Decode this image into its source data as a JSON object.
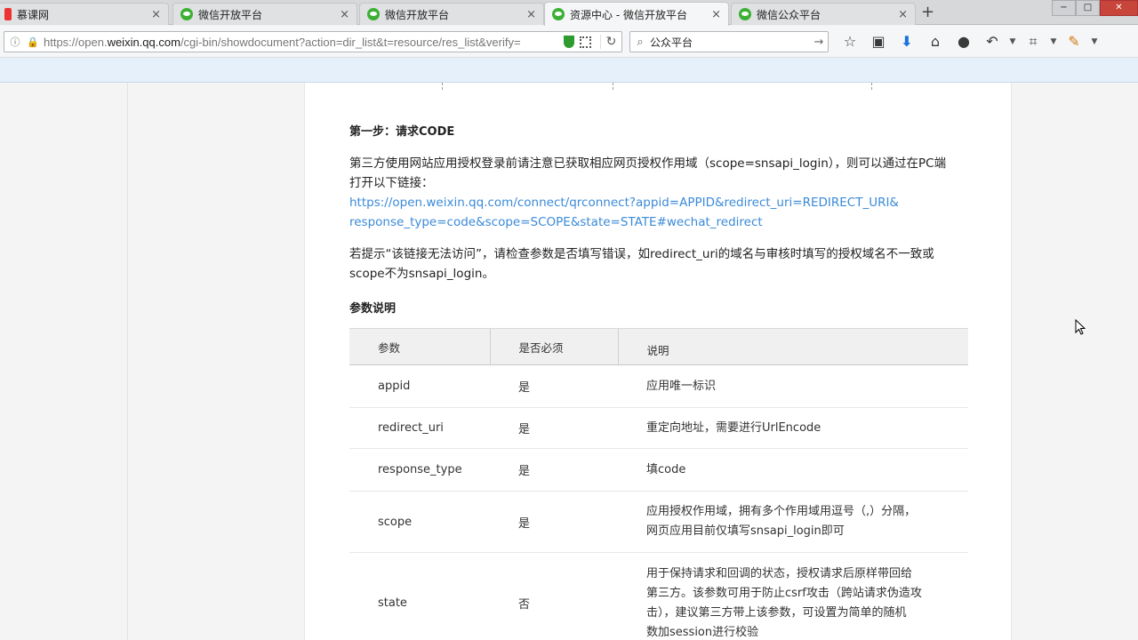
{
  "browser": {
    "tabs": [
      {
        "label": "慕课网",
        "icon": "imooc-favicon"
      },
      {
        "label": "微信开放平台",
        "icon": "wechat-favicon"
      },
      {
        "label": "微信开放平台",
        "icon": "wechat-favicon"
      },
      {
        "label": "资源中心 - 微信开放平台",
        "icon": "wechat-favicon",
        "active": true
      },
      {
        "label": "微信公众平台",
        "icon": "wechat-favicon"
      }
    ],
    "tab_close": "×",
    "new_tab": "+",
    "window_controls": {
      "minimize": "−",
      "maximize": "□",
      "close": "✕"
    },
    "url": {
      "prefix": "https://open.",
      "domain": "weixin.qq.com",
      "rest": "/cgi-bin/showdocument?action=dir_list&t=resource/res_list&verify="
    },
    "search": {
      "value": "公众平台"
    }
  },
  "doc": {
    "step_title": "第一步：请求CODE",
    "para1_line1": "第三方使用网站应用授权登录前请注意已获取相应网页授权作用域（scope=snsapi_login），则可以通过在PC端",
    "para1_line2": "打开以下链接：",
    "link_line1": "https://open.weixin.qq.com/connect/qrconnect?appid=APPID&redirect_uri=REDIRECT_URI&",
    "link_line2": "response_type=code&scope=SCOPE&state=STATE#wechat_redirect",
    "para2_line1": "若提示“该链接无法访问”，请检查参数是否填写错误，如redirect_uri的域名与审核时填写的授权域名不一致或",
    "para2_line2": "scope不为snsapi_login。",
    "params_title": "参数说明",
    "table": {
      "headers": [
        "参数",
        "是否必须",
        "说明"
      ],
      "rows": [
        {
          "param": "appid",
          "required": "是",
          "desc": [
            "应用唯一标识"
          ]
        },
        {
          "param": "redirect_uri",
          "required": "是",
          "desc": [
            "重定向地址，需要进行UrlEncode"
          ]
        },
        {
          "param": "response_type",
          "required": "是",
          "desc": [
            "填code"
          ]
        },
        {
          "param": "scope",
          "required": "是",
          "desc": [
            "应用授权作用域，拥有多个作用域用逗号（,）分隔，",
            "网页应用目前仅填写snsapi_login即可"
          ]
        },
        {
          "param": "state",
          "required": "否",
          "desc": [
            "用于保持请求和回调的状态，授权请求后原样带回给",
            "第三方。该参数可用于防止csrf攻击（跨站请求伪造攻",
            "击），建议第三方带上该参数，可设置为简单的随机",
            "数加session进行校验"
          ]
        }
      ]
    }
  },
  "colors": {
    "link": "#3a8ad8",
    "wechat_green": "#3cb034",
    "table_header_bg": "#f0f0f0"
  }
}
